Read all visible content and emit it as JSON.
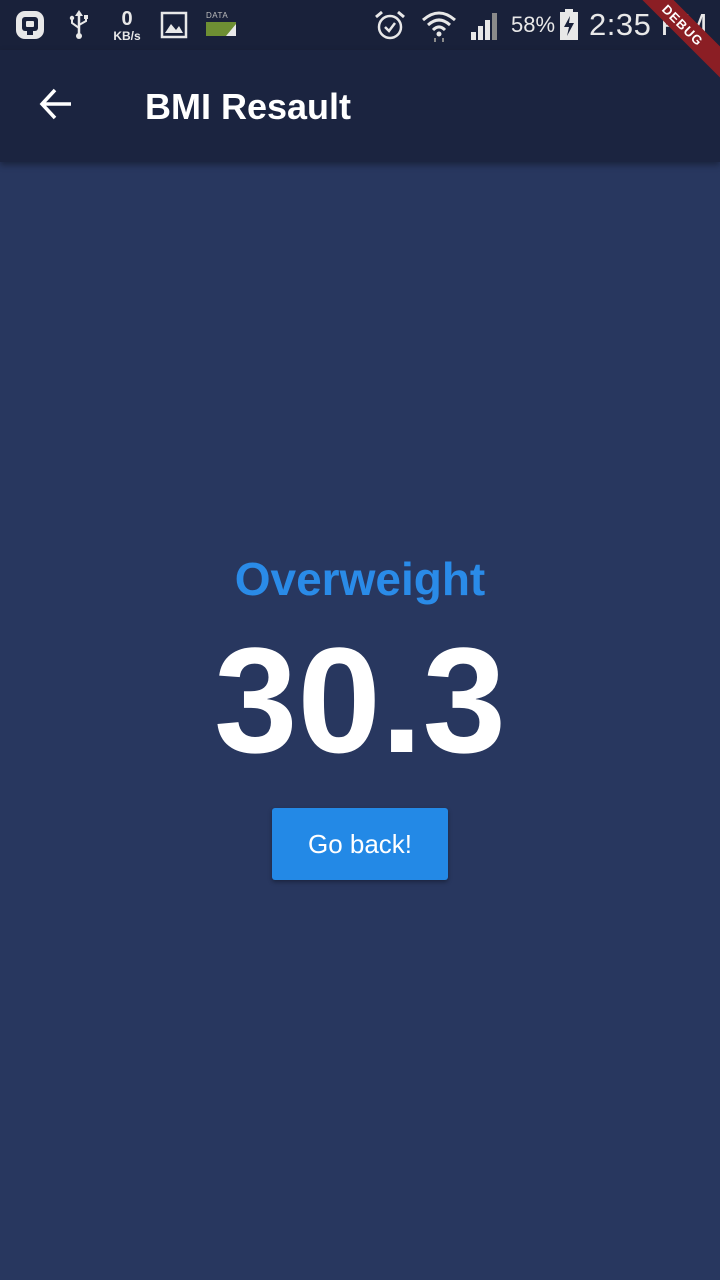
{
  "status_bar": {
    "icons_left": [
      "app-notification-icon",
      "usb-icon",
      "gallery-icon",
      "mobile-data-icon"
    ],
    "net_speed_value": "0",
    "net_speed_unit": "KB/s",
    "data_label": "DATA",
    "icons_right": [
      "alarm-icon",
      "wifi-icon",
      "signal-icon",
      "battery-charging-icon"
    ],
    "battery_percent": "58%",
    "time": "2:35 PM"
  },
  "debug_banner": "DEBUG",
  "app_bar": {
    "back_icon": "arrow-back-icon",
    "title": "BMI Resault"
  },
  "result": {
    "category": "Overweight",
    "bmi": "30.3",
    "go_back_label": "Go back!"
  },
  "colors": {
    "background": "#28375f",
    "app_bar": "#1b2440",
    "status_bar": "#19213a",
    "accent": "#2a8be8",
    "button": "#2389e6"
  }
}
